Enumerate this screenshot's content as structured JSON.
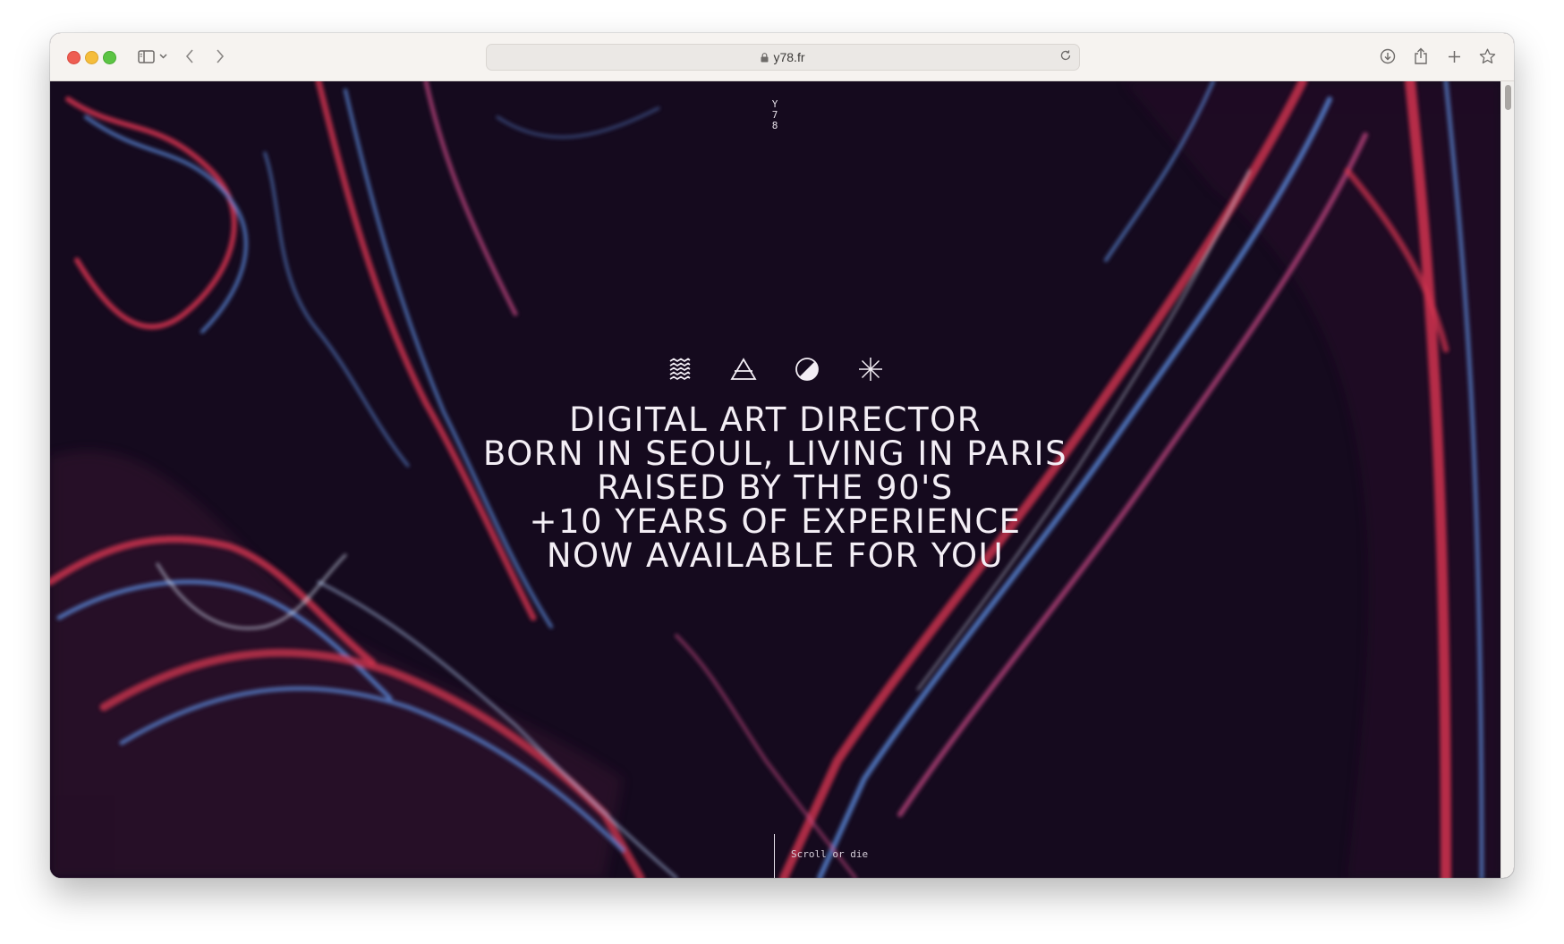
{
  "browser": {
    "url": "y78.fr",
    "colors": {
      "titlebar": "#f6f3f0",
      "close": "#ee5d52",
      "minimize": "#f5bd3b",
      "maximize": "#5cc444"
    },
    "icons": [
      "sidebar-icon",
      "chevron-down-icon",
      "back-icon",
      "forward-icon",
      "lock-icon",
      "reload-icon",
      "download-icon",
      "share-icon",
      "new-tab-icon",
      "bookmark-icon"
    ]
  },
  "site": {
    "logo_chars": [
      "Y",
      "7",
      "8"
    ],
    "symbol_icons": [
      "water-wave-icon",
      "air-triangle-icon",
      "half-moon-icon",
      "asterisk-icon"
    ],
    "headline": [
      "DIGITAL ART DIRECTOR",
      "BORN IN SEOUL, LIVING IN PARIS",
      "RAISED BY THE 90'S",
      "+10 YEARS OF EXPERIENCE",
      "NOW AVAILABLE FOR YOU"
    ],
    "scroll_hint": "Scroll or die",
    "colors": {
      "background": "#150a1e",
      "red_lines": "#d2344f",
      "blue_lines": "#5b8ad9",
      "text": "#f3eef5"
    }
  }
}
